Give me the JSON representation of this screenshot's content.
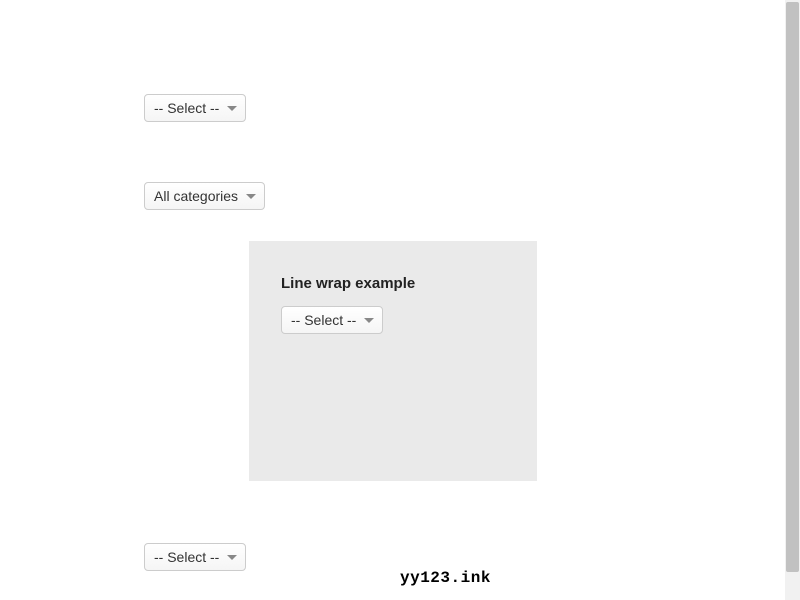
{
  "selects": {
    "first": {
      "label": "-- Select --"
    },
    "second": {
      "label": "All categories"
    },
    "panel": {
      "label": "-- Select --"
    },
    "third": {
      "label": "-- Select --"
    }
  },
  "panel": {
    "title": "Line wrap example"
  },
  "watermark": "yy123.ink"
}
